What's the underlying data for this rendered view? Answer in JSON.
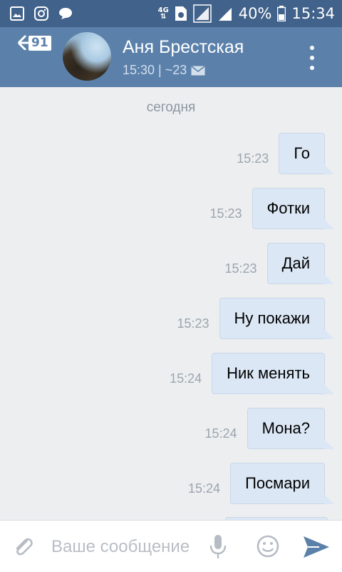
{
  "status_bar": {
    "network_type": "4G",
    "battery_percent": "40%",
    "time": "15:34"
  },
  "header": {
    "unread_count": "91",
    "contact_name": "Аня Брестская",
    "last_seen": "15:30 | ~23"
  },
  "chat": {
    "date_separator": "сегодня",
    "messages": [
      {
        "text": "Го",
        "time": "15:23"
      },
      {
        "text": "Фотки",
        "time": "15:23"
      },
      {
        "text": "Дай",
        "time": "15:23"
      },
      {
        "text": "Ну покажи",
        "time": "15:23"
      },
      {
        "text": "Ник менять",
        "time": "15:24"
      },
      {
        "text": "Мона?",
        "time": "15:24"
      },
      {
        "text": "Посмари",
        "time": "15:24"
      }
    ]
  },
  "composer": {
    "placeholder": "Ваше сообщение"
  },
  "colors": {
    "status_bar": "#41628a",
    "header": "#5b81ab",
    "background": "#edeef0",
    "bubble": "#dbe7f5",
    "accent": "#5b81ab"
  },
  "icons": {
    "status_left": [
      "gallery-icon",
      "instagram-icon",
      "chat-bubble-icon"
    ],
    "status_right": [
      "network-type-icon",
      "sim-icon",
      "signal-icon",
      "battery-icon"
    ],
    "header": [
      "back-arrow-icon",
      "mail-icon",
      "more-vertical-icon"
    ],
    "composer": [
      "paperclip-icon",
      "microphone-icon",
      "emoji-icon",
      "send-icon"
    ]
  }
}
